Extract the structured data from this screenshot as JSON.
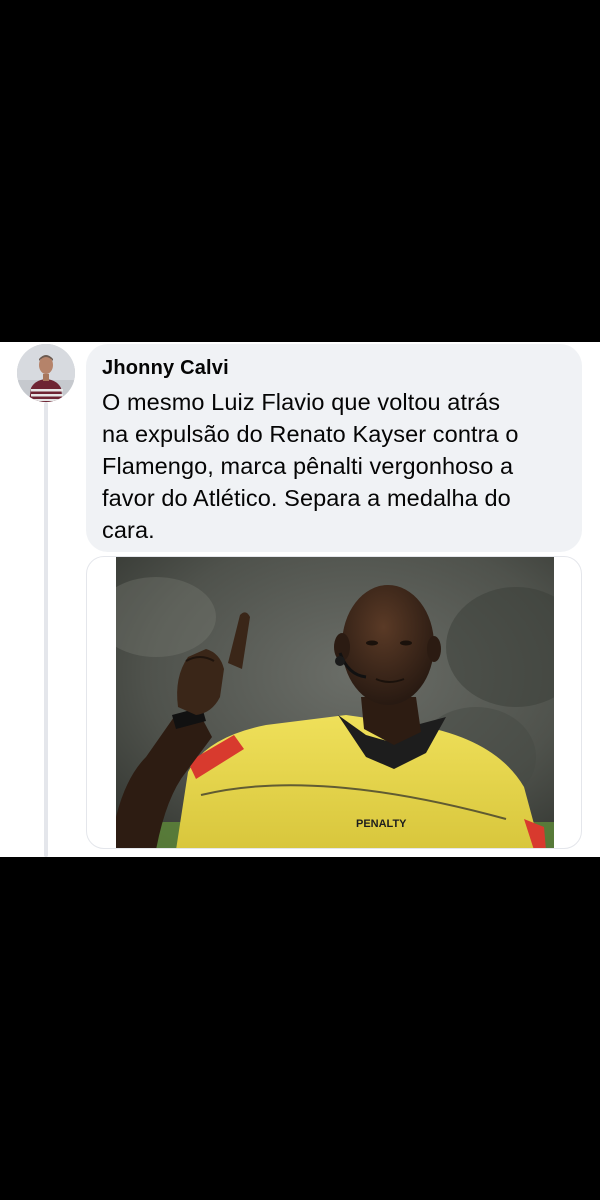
{
  "comment": {
    "author": "Jhonny Calvi",
    "text": "O mesmo Luiz Flavio que voltou atrás\nna expulsão do Renato Kayser contra o\nFlamengo, marca pênalti vergonhoso a\nfavor do Atlético. Separa a medalha do\ncara.",
    "avatar_icon": "profile-photo",
    "attachment": {
      "kind": "photo",
      "subject": "referee-raising-finger",
      "jersey_brand": "PENALTY",
      "colors": {
        "jersey": "#e9d94a",
        "collar": "#1d1d1d",
        "skin": "#3a2618",
        "background": "#5b5e58"
      }
    }
  }
}
